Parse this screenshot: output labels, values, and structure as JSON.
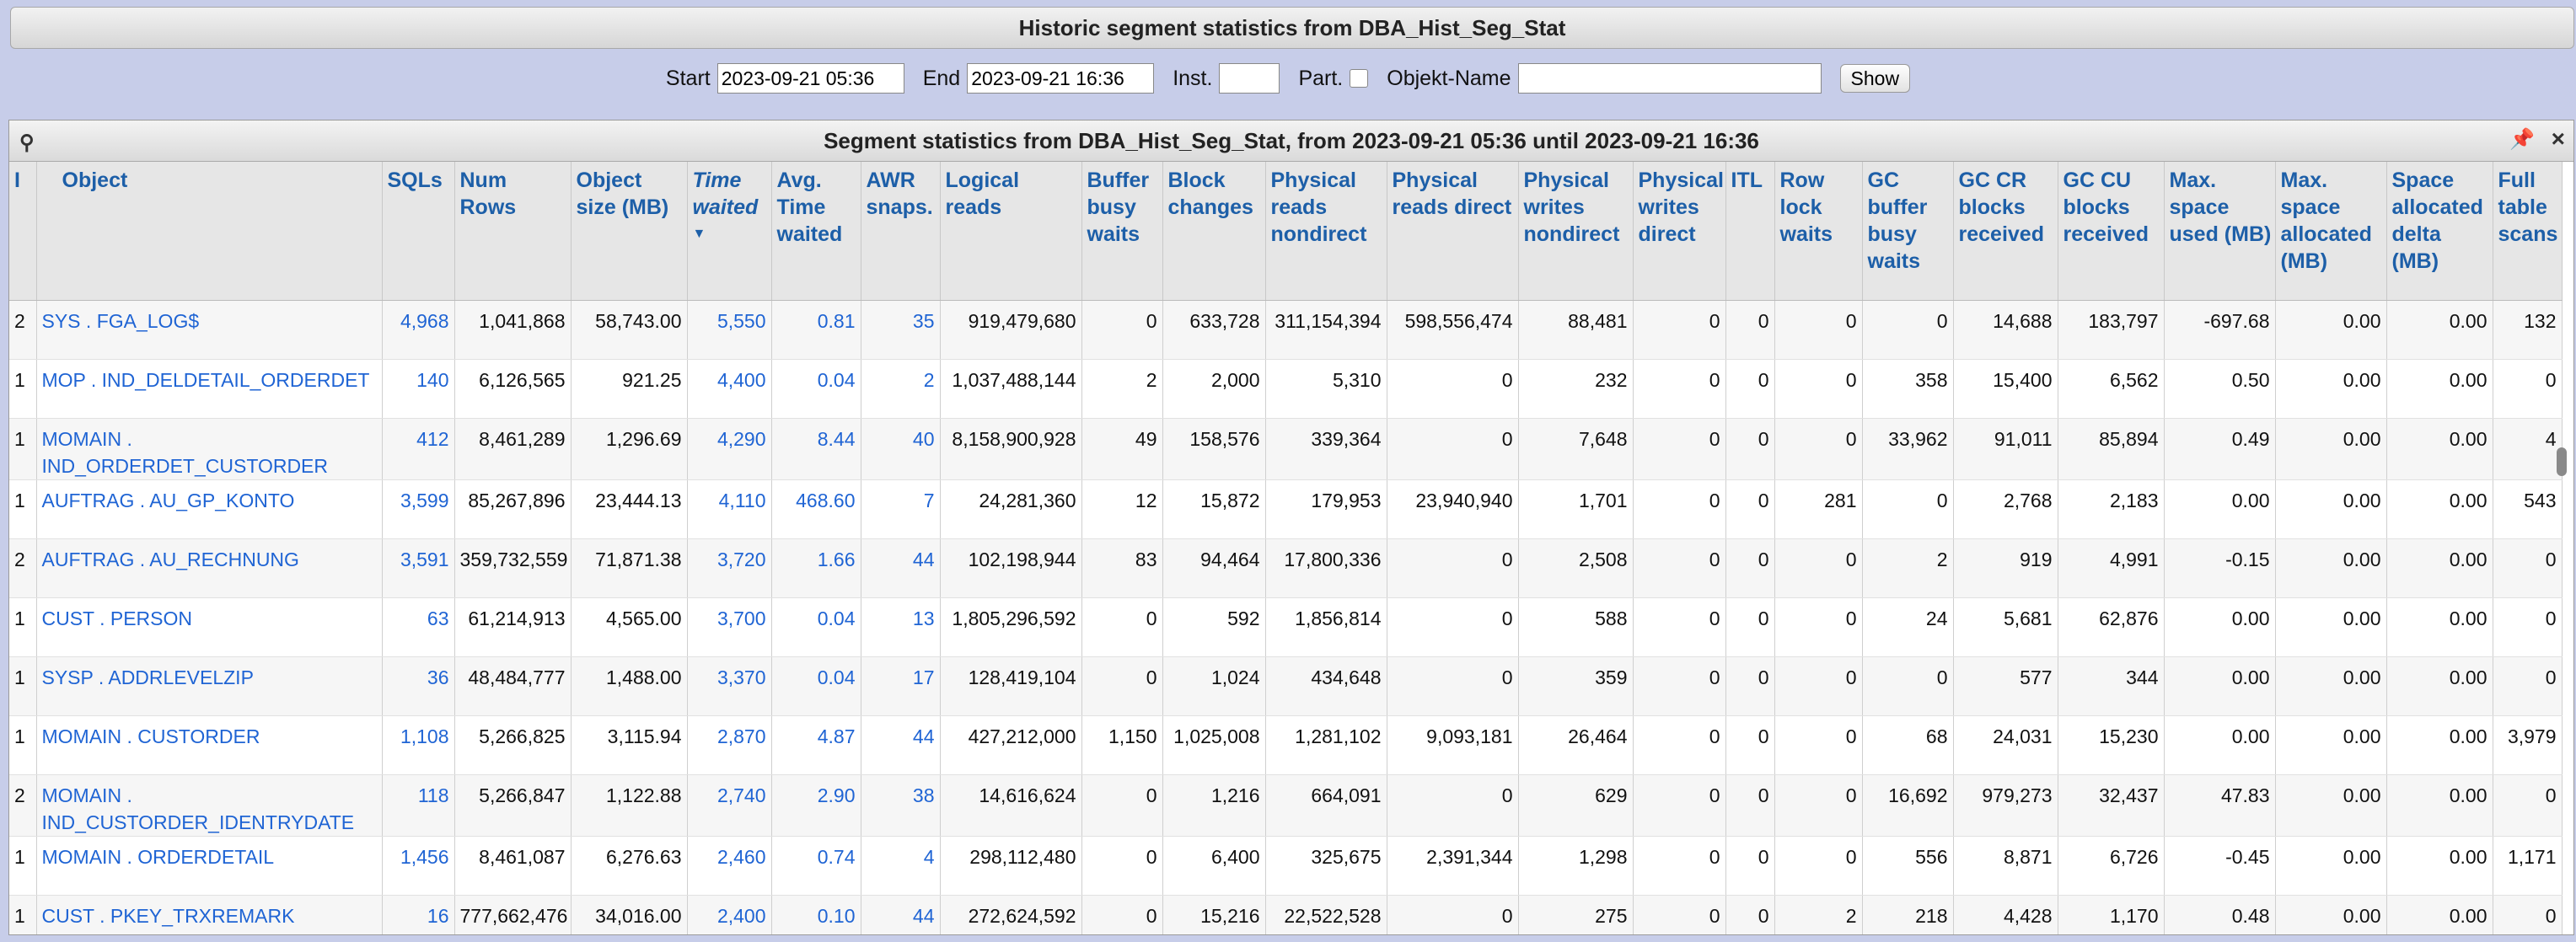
{
  "header": {
    "title": "Historic segment statistics from DBA_Hist_Seg_Stat"
  },
  "filters": {
    "start_label": "Start",
    "start_value": "2023-09-21 05:36",
    "end_label": "End",
    "end_value": "2023-09-21 16:36",
    "inst_label": "Inst.",
    "inst_value": "",
    "part_label": "Part.",
    "object_label": "Objekt-Name",
    "object_value": "",
    "show_label": "Show"
  },
  "grid": {
    "title": "Segment statistics from DBA_Hist_Seg_Stat, from 2023-09-21 05:36 until 2023-09-21 16:36",
    "columns": [
      "I",
      "Object",
      "SQLs",
      "Num Rows",
      "Object size (MB)",
      "Time waited",
      "Avg. Time waited",
      "AWR snaps.",
      "Logical reads",
      "Buffer busy waits",
      "Block changes",
      "Physical reads nondirect",
      "Physical reads direct",
      "Physical writes nondirect",
      "Physical writes direct",
      "ITL",
      "Row lock waits",
      "GC buffer busy waits",
      "GC CR blocks received",
      "GC CU blocks received",
      "Max. space used (MB)",
      "Max. space allocated (MB)",
      "Space allocated delta (MB)",
      "Full table scans"
    ],
    "rows": [
      [
        "2",
        "SYS . FGA_LOG$",
        "4,968",
        "1,041,868",
        "58,743.00",
        "5,550",
        "0.81",
        "35",
        "919,479,680",
        "0",
        "633,728",
        "311,154,394",
        "598,556,474",
        "88,481",
        "0",
        "0",
        "0",
        "0",
        "14,688",
        "183,797",
        "-697.68",
        "0.00",
        "0.00",
        "132"
      ],
      [
        "1",
        "MOP . IND_DELDETAIL_ORDERDET",
        "140",
        "6,126,565",
        "921.25",
        "4,400",
        "0.04",
        "2",
        "1,037,488,144",
        "2",
        "2,000",
        "5,310",
        "0",
        "232",
        "0",
        "0",
        "0",
        "358",
        "15,400",
        "6,562",
        "0.50",
        "0.00",
        "0.00",
        "0"
      ],
      [
        "1",
        "MOMAIN . IND_ORDERDET_CUSTORDER",
        "412",
        "8,461,289",
        "1,296.69",
        "4,290",
        "8.44",
        "40",
        "8,158,900,928",
        "49",
        "158,576",
        "339,364",
        "0",
        "7,648",
        "0",
        "0",
        "0",
        "33,962",
        "91,011",
        "85,894",
        "0.49",
        "0.00",
        "0.00",
        "4"
      ],
      [
        "1",
        "AUFTRAG . AU_GP_KONTO",
        "3,599",
        "85,267,896",
        "23,444.13",
        "4,110",
        "468.60",
        "7",
        "24,281,360",
        "12",
        "15,872",
        "179,953",
        "23,940,940",
        "1,701",
        "0",
        "0",
        "281",
        "0",
        "2,768",
        "2,183",
        "0.00",
        "0.00",
        "0.00",
        "543"
      ],
      [
        "2",
        "AUFTRAG . AU_RECHNUNG",
        "3,591",
        "359,732,559",
        "71,871.38",
        "3,720",
        "1.66",
        "44",
        "102,198,944",
        "83",
        "94,464",
        "17,800,336",
        "0",
        "2,508",
        "0",
        "0",
        "0",
        "2",
        "919",
        "4,991",
        "-0.15",
        "0.00",
        "0.00",
        "0"
      ],
      [
        "1",
        "CUST . PERSON",
        "63",
        "61,214,913",
        "4,565.00",
        "3,700",
        "0.04",
        "13",
        "1,805,296,592",
        "0",
        "592",
        "1,856,814",
        "0",
        "588",
        "0",
        "0",
        "0",
        "24",
        "5,681",
        "62,876",
        "0.00",
        "0.00",
        "0.00",
        "0"
      ],
      [
        "1",
        "SYSP . ADDRLEVELZIP",
        "36",
        "48,484,777",
        "1,488.00",
        "3,370",
        "0.04",
        "17",
        "128,419,104",
        "0",
        "1,024",
        "434,648",
        "0",
        "359",
        "0",
        "0",
        "0",
        "0",
        "577",
        "344",
        "0.00",
        "0.00",
        "0.00",
        "0"
      ],
      [
        "1",
        "MOMAIN . CUSTORDER",
        "1,108",
        "5,266,825",
        "3,115.94",
        "2,870",
        "4.87",
        "44",
        "427,212,000",
        "1,150",
        "1,025,008",
        "1,281,102",
        "9,093,181",
        "26,464",
        "0",
        "0",
        "0",
        "68",
        "24,031",
        "15,230",
        "0.00",
        "0.00",
        "0.00",
        "3,979"
      ],
      [
        "2",
        "MOMAIN . IND_CUSTORDER_IDENTRYDATE",
        "118",
        "5,266,847",
        "1,122.88",
        "2,740",
        "2.90",
        "38",
        "14,616,624",
        "0",
        "1,216",
        "664,091",
        "0",
        "629",
        "0",
        "0",
        "0",
        "16,692",
        "979,273",
        "32,437",
        "47.83",
        "0.00",
        "0.00",
        "0"
      ],
      [
        "1",
        "MOMAIN . ORDERDETAIL",
        "1,456",
        "8,461,087",
        "6,276.63",
        "2,460",
        "0.74",
        "4",
        "298,112,480",
        "0",
        "6,400",
        "325,675",
        "2,391,344",
        "1,298",
        "0",
        "0",
        "0",
        "556",
        "8,871",
        "6,726",
        "-0.45",
        "0.00",
        "0.00",
        "1,171"
      ],
      [
        "1",
        "CUST . PKEY_TRXREMARK",
        "16",
        "777,662,476",
        "34,016.00",
        "2,400",
        "0.10",
        "44",
        "272,624,592",
        "0",
        "15,216",
        "22,522,528",
        "0",
        "275",
        "0",
        "0",
        "2",
        "218",
        "4,428",
        "1,170",
        "0.48",
        "0.00",
        "0.00",
        "0"
      ]
    ]
  }
}
